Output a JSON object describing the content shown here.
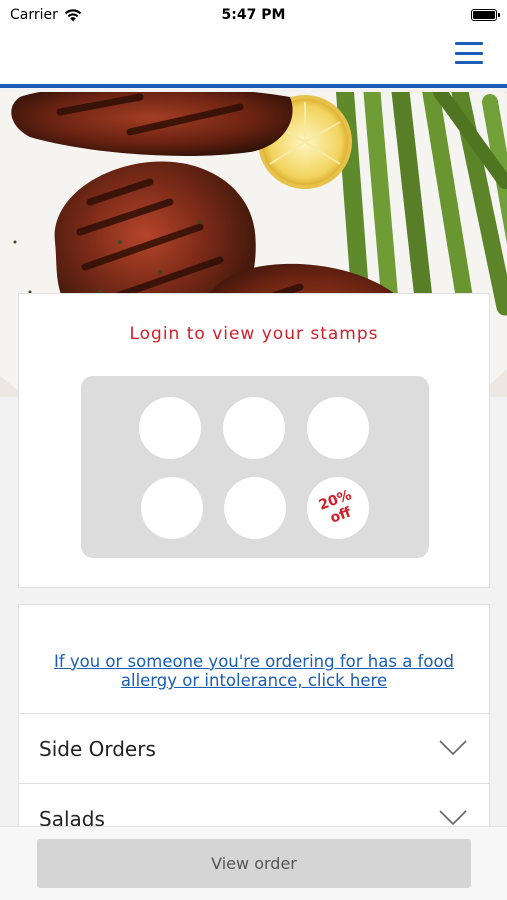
{
  "status_bar": {
    "carrier": "Carrier",
    "time": "5:47 PM"
  },
  "header": {
    "menu_icon": "hamburger-menu-icon",
    "accent_color": "#1a5eb8"
  },
  "hero": {
    "image": "grilled-chicken-asparagus-lemon-photo"
  },
  "stamp_card": {
    "title": "Login to view your stamps",
    "stamps_total": 6,
    "reward_text": "20% off",
    "title_color": "#d0202a"
  },
  "menu": {
    "allergy_link": "If you or someone you're ordering for has a food allergy or intolerance, click here",
    "categories": [
      {
        "label": "Side Orders",
        "icon": "chevron-down-icon"
      },
      {
        "label": "Salads",
        "icon": "chevron-down-icon"
      }
    ]
  },
  "bottom_bar": {
    "view_order_label": "View order"
  }
}
